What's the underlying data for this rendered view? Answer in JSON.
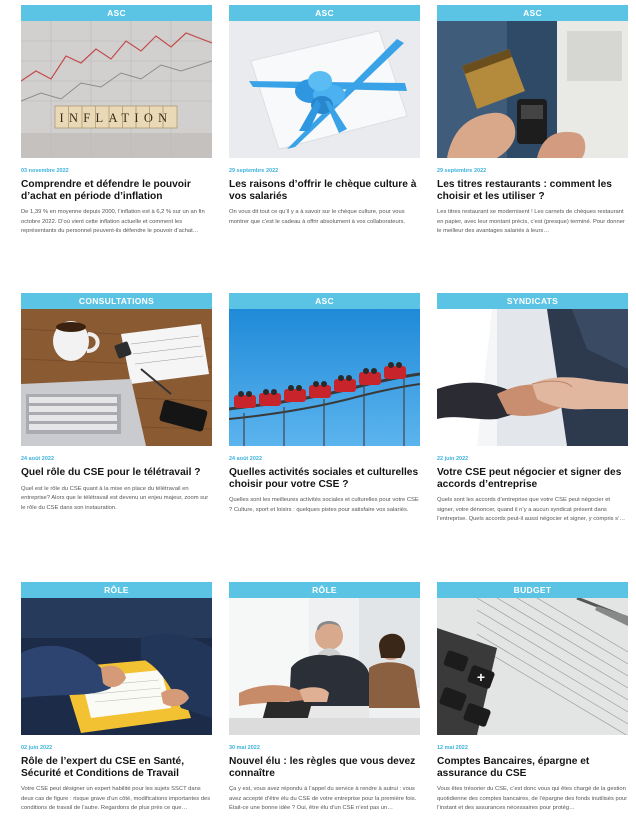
{
  "colors": {
    "category_bg": "#5bc4e5",
    "date": "#3cb2de",
    "title": "#141414",
    "excerpt": "#555555"
  },
  "articles": [
    {
      "category": "ASC",
      "image_icon": "inflation-photo",
      "date": "03 novembre 2022",
      "title": "Comprendre et défendre le pouvoir d’achat en période d’inflation",
      "excerpt": "De 1,39 % en moyenne depuis 2000, l’inflation est à 6,2 % sur un an fin octobre 2022. D’où vient cette inflation actuelle et comment les représentants du personnel peuvent-ils défendre le pouvoir d’achat…",
      "image_text": "INFLATION"
    },
    {
      "category": "ASC",
      "image_icon": "gift-card-photo",
      "date": "29 septembre 2022",
      "title": "Les raisons d’offrir le chèque culture à vos salariés",
      "excerpt": "On vous dit tout ce qu’il y a à savoir sur le chèque culture, pour vous montrer que c’est le cadeau à offrir absolument à vos collaborateurs."
    },
    {
      "category": "ASC",
      "image_icon": "card-payment-photo",
      "date": "29 septembre 2022",
      "title": "Les titres restaurants : comment les choisir et les utiliser ?",
      "excerpt": "Les titres restaurant se modernisent ! Les carnets de chèques restaurant en papier, avec leur montant précis, c’est (presque) terminé. Pour donner le meilleur des avantages salariés à leurs…"
    },
    {
      "category": "CONSULTATIONS",
      "image_icon": "laptop-desk-photo",
      "date": "24 août 2022",
      "title": "Quel rôle du CSE pour le télétravail ?",
      "excerpt": "Quel est le rôle du CSE quant à la mise en place du télétravail en entreprise? Alors que le télétravail est devenu un enjeu majeur, zoom sur le rôle du CSE dans son instauration."
    },
    {
      "category": "ASC",
      "image_icon": "roller-coaster-photo",
      "date": "24 août 2022",
      "title": "Quelles activités sociales et culturelles choisir pour votre CSE ?",
      "excerpt": "Quelles sont les meilleures activités sociales et culturelles pour votre CSE ? Culture, sport et loisirs : quelques pistes pour satisfaire vos salariés."
    },
    {
      "category": "SYNDICATS",
      "image_icon": "handshake-photo",
      "date": "22 juin 2022",
      "title": "Votre CSE peut négocier et signer des accords d’entreprise",
      "excerpt": "Quels sont les accords d’entreprise que votre CSE peut négocier et signer, votre dénoncer, quand il n’y a aucun syndicat présent dans l’entreprise. Quels accords peut-il aussi négocier et signer, y compris s’…"
    },
    {
      "category": "RÔLE",
      "image_icon": "documents-photo",
      "date": "02 juin 2022",
      "title": "Rôle de l’expert du CSE en Santé, Sécurité et Conditions de Travail",
      "excerpt": "Votre CSE peut désigner un expert habilité pour les sujets SSCT dans deux cas de figure : risque grave d’un côté, modifications importantes des conditions de travail de l’autre. Regardons de plus près ce que…"
    },
    {
      "category": "RÔLE",
      "image_icon": "meeting-handshake-photo",
      "date": "30 mai 2022",
      "title": "Nouvel élu : les règles que vous devez connaître",
      "excerpt": "Ça y est, vous avez répondu à l’appel du service à rendre à autrui : vous avez accepté d’être élu du CSE de votre entreprise pour la première fois. Était-ce une bonne idée ? Oui, être élu d’un CSE n’est pas un…"
    },
    {
      "category": "BUDGET",
      "image_icon": "calculator-photo",
      "date": "12 mai 2022",
      "title": "Comptes Bancaires, épargne et assurance du CSE",
      "excerpt": "Vous êtes trésorier du CSE, c’est donc vous qui êtes chargé de la gestion quotidienne des comptes bancaires, de l’épargne des fonds inutilisés pour l’instant et des assurances nécessaires pour protég…"
    }
  ]
}
